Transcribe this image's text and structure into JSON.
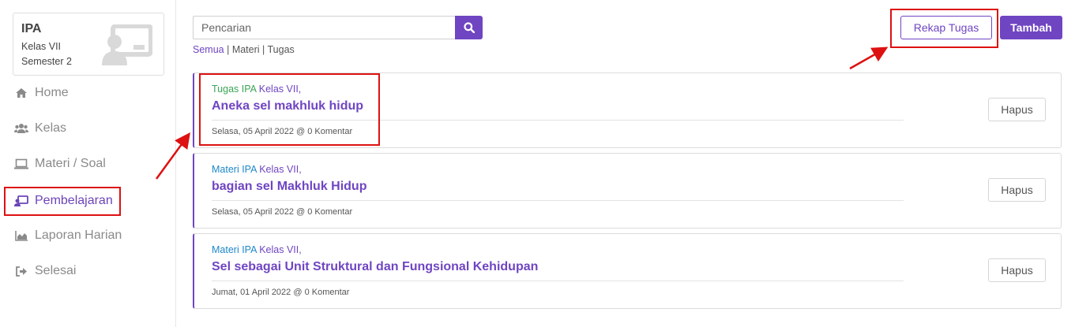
{
  "class_card": {
    "subject": "IPA",
    "grade": "Kelas VII",
    "semester": "Semester 2",
    "icon": "teacher-board-icon"
  },
  "sidebar": {
    "items": [
      {
        "label": "Home",
        "icon": "home-icon"
      },
      {
        "label": "Kelas",
        "icon": "users-icon"
      },
      {
        "label": "Materi / Soal",
        "icon": "laptop-icon"
      },
      {
        "label": "Pembelajaran",
        "icon": "teacher-icon",
        "active": true
      },
      {
        "label": "Laporan Harian",
        "icon": "area-chart-icon"
      },
      {
        "label": "Selesai",
        "icon": "sign-out-icon"
      }
    ]
  },
  "search": {
    "placeholder": "Pencarian",
    "value": "",
    "button_icon": "search-icon"
  },
  "filters": {
    "all": "Semua",
    "sep1": " | ",
    "materi": "Materi",
    "sep2": " | ",
    "tugas": "Tugas"
  },
  "toolbar": {
    "rekap_label": "Rekap Tugas",
    "tambah_label": "Tambah"
  },
  "items": [
    {
      "kind": "Tugas IPA",
      "kelas": "Kelas VII,",
      "title": "Aneka sel makhluk hidup",
      "date": "Selasa, 05 April 2022 @ 0 Komentar",
      "delete_label": "Hapus"
    },
    {
      "kind": "Materi IPA",
      "kelas": "Kelas VII,",
      "title": "bagian sel Makhluk Hidup",
      "date": "Selasa, 05 April 2022 @ 0 Komentar",
      "delete_label": "Hapus"
    },
    {
      "kind": "Materi IPA",
      "kelas": "Kelas VII,",
      "title": "Sel sebagai Unit Struktural dan Fungsional Kehidupan",
      "date": "Jumat, 01 April 2022 @ 0 Komentar",
      "delete_label": "Hapus"
    }
  ],
  "colors": {
    "accent": "#6f45c2",
    "tugas": "#3aa655",
    "materi": "#1e88c9",
    "annotation": "#dd1111"
  }
}
